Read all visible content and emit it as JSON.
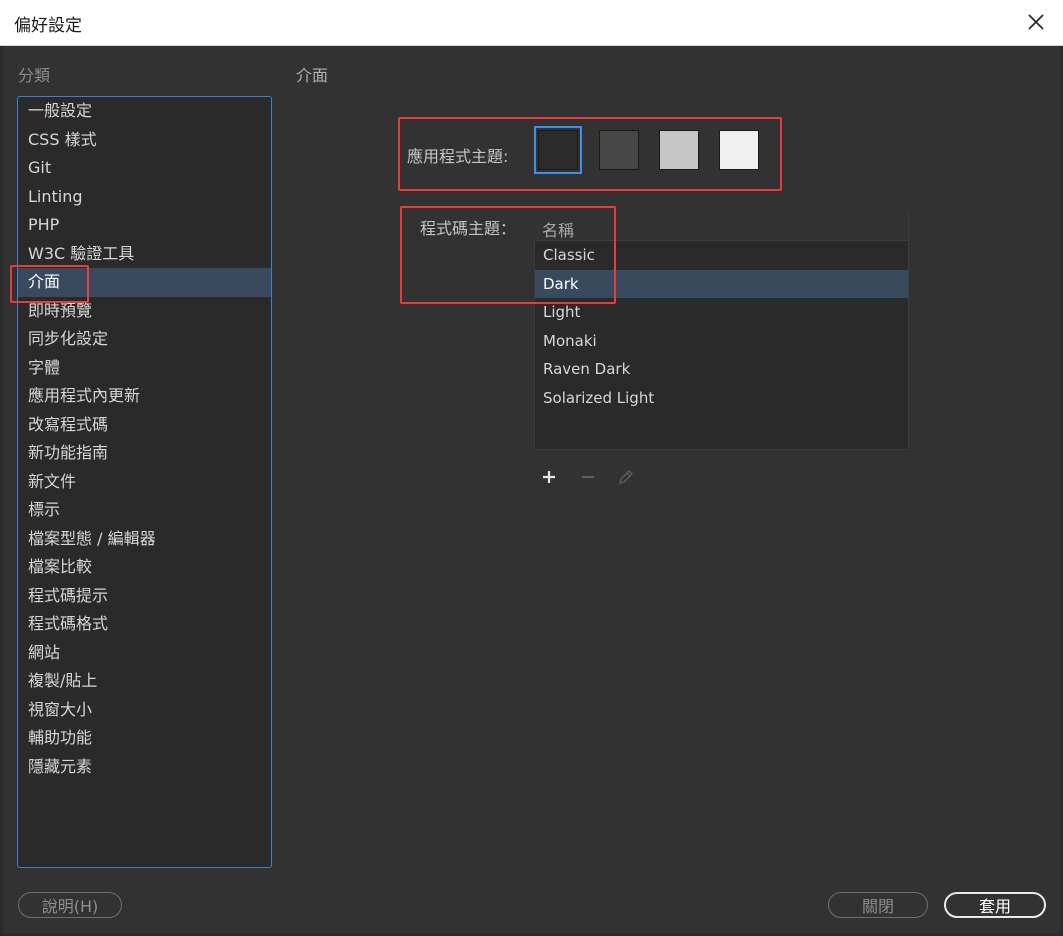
{
  "window": {
    "title": "偏好設定",
    "close_icon": "close-icon"
  },
  "sidebar": {
    "label": "分類",
    "items": [
      "一般設定",
      "CSS 樣式",
      "Git",
      "Linting",
      "PHP",
      "W3C 驗證工具",
      "介面",
      "即時預覽",
      "同步化設定",
      "字體",
      "應用程式內更新",
      "改寫程式碼",
      "新功能指南",
      "新文件",
      "標示",
      "檔案型態 / 編輯器",
      "檔案比較",
      "程式碼提示",
      "程式碼格式",
      "網站",
      "複製/貼上",
      "視窗大小",
      "輔助功能",
      "隱藏元素"
    ],
    "active_index": 6
  },
  "main": {
    "section_title": "介面",
    "app_theme": {
      "label": "應用程式主題:",
      "swatches": [
        "#2b2b2b",
        "#474747",
        "#c6c6c6",
        "#f0f0f0"
      ],
      "selected_index": 0
    },
    "code_theme": {
      "label": "程式碼主題：",
      "column_header": "名稱",
      "items": [
        "Classic",
        "Dark",
        "Light",
        "Monaki",
        "Raven Dark",
        "Solarized Light"
      ],
      "selected_index": 1
    },
    "toolbar": {
      "add_icon": "plus-icon",
      "remove_icon": "minus-icon",
      "edit_icon": "pencil-icon"
    }
  },
  "footer": {
    "help_label": "說明(H)",
    "close_label": "關閉",
    "apply_label": "套用"
  },
  "colors": {
    "highlight_box": "#e23e3e",
    "selection": "#3a4a5e",
    "focus": "#3d8fe8"
  }
}
